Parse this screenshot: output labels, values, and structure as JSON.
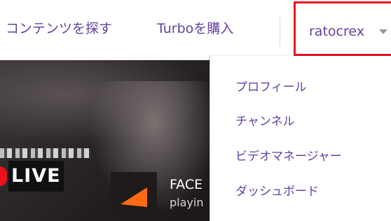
{
  "nav": {
    "browse_label": "コンテンツを探す",
    "turbo_label": "Turboを購入"
  },
  "user": {
    "name": "ratocrex",
    "caret_icon": "caret-down-icon"
  },
  "stream": {
    "live_label": "LIVE",
    "title": "FACE",
    "game": "playin"
  },
  "dropdown": {
    "items": [
      {
        "label": "プロフィール"
      },
      {
        "label": "チャンネル"
      },
      {
        "label": "ビデオマネージャー"
      },
      {
        "label": "ダッシュボード"
      }
    ]
  },
  "colors": {
    "accent": "#6441a5",
    "highlight_border": "#e8121f",
    "live_red": "#e8121f",
    "channel_orange": "#ff6a13"
  }
}
